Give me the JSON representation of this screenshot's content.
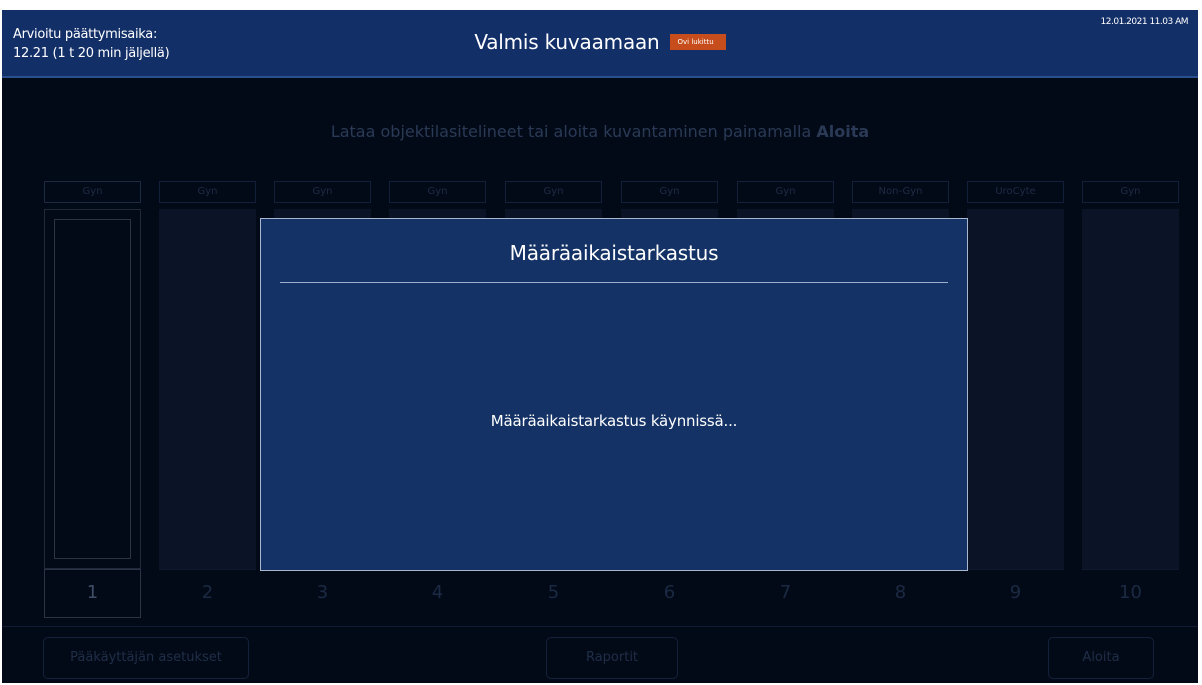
{
  "header": {
    "eta_label": "Arvioitu päättymisaika:",
    "eta_value": "12.21 (1 t 20 min jäljellä)",
    "title": "Valmis kuvaamaan",
    "door_badge": "Ovi lukittu",
    "datetime": "12.01.2021 11.03 AM"
  },
  "instruction": {
    "text": "Lataa objektilasitelineet tai aloita kuvantaminen painamalla ",
    "bold": "Aloita"
  },
  "slots": [
    {
      "label": "Gyn",
      "number": "1"
    },
    {
      "label": "Gyn",
      "number": "2"
    },
    {
      "label": "Gyn",
      "number": "3"
    },
    {
      "label": "Gyn",
      "number": "4"
    },
    {
      "label": "Gyn",
      "number": "5"
    },
    {
      "label": "Gyn",
      "number": "6"
    },
    {
      "label": "Gyn",
      "number": "7"
    },
    {
      "label": "Non-Gyn",
      "number": "8"
    },
    {
      "label": "UroCyte",
      "number": "9"
    },
    {
      "label": "Gyn",
      "number": "10"
    }
  ],
  "footer": {
    "admin_settings": "Pääkäyttäjän asetukset",
    "reports": "Raportit",
    "start": "Aloita"
  },
  "modal": {
    "title": "Määräaikaistarkastus",
    "message": "Määräaikaistarkastus käynnissä..."
  }
}
